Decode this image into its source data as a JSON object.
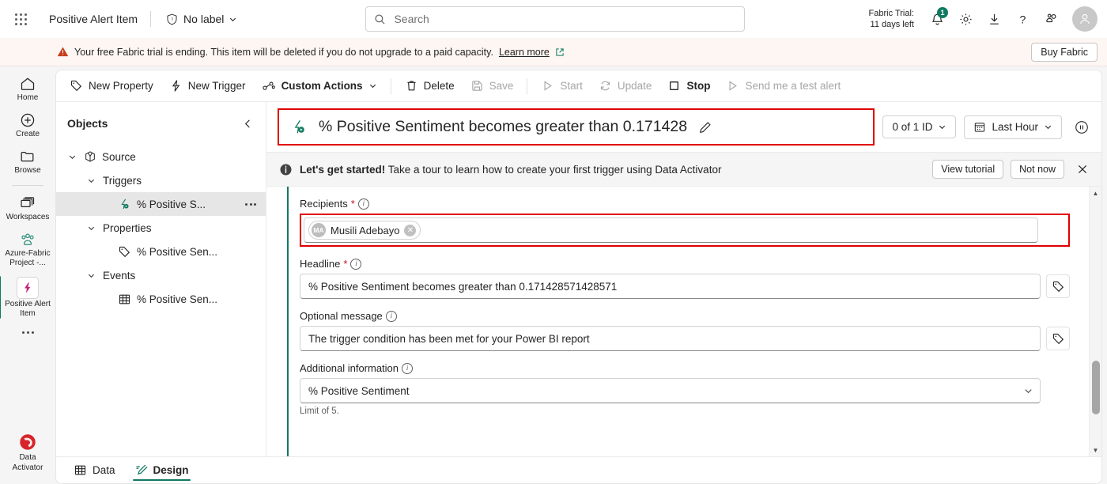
{
  "topbar": {
    "waffle_name": "app-launcher",
    "app_title": "Positive Alert Item",
    "label": "No label",
    "search_placeholder": "Search",
    "search_value": "",
    "trial_line1": "Fabric Trial:",
    "trial_line2": "11 days left",
    "notification_count": "1",
    "avatar_initial": ""
  },
  "trial_banner": {
    "message": "Your free Fabric trial is ending. This item will be deleted if you do not upgrade to a paid capacity.",
    "link": "Learn more",
    "buy_button": "Buy Fabric"
  },
  "rail": {
    "items": [
      {
        "label": "Home",
        "icon": "home-icon"
      },
      {
        "label": "Create",
        "icon": "plus-circle-icon"
      },
      {
        "label": "Browse",
        "icon": "folder-icon"
      },
      {
        "label": "Workspaces",
        "icon": "workspaces-icon"
      },
      {
        "label": "Azure-Fabric Project -...",
        "icon": "people-icon"
      },
      {
        "label": "Positive Alert Item",
        "icon": "activator-item-icon"
      }
    ],
    "more_label": "More options",
    "product": {
      "label_line1": "Data",
      "label_line2": "Activator",
      "icon": "data-activator-icon"
    }
  },
  "commandbar": {
    "items": [
      {
        "label": "New Property",
        "icon": "tag-icon",
        "disabled": false,
        "strong": false
      },
      {
        "label": "New Trigger",
        "icon": "bolt-icon",
        "disabled": false,
        "strong": false
      },
      {
        "label": "Custom Actions",
        "icon": "custom-actions-icon",
        "disabled": false,
        "strong": true,
        "caret": true
      },
      {
        "label": "Delete",
        "icon": "trash-icon",
        "disabled": false,
        "strong": false
      },
      {
        "label": "Save",
        "icon": "save-icon",
        "disabled": true,
        "strong": false
      },
      {
        "label": "Start",
        "icon": "play-icon",
        "disabled": true,
        "strong": false
      },
      {
        "label": "Update",
        "icon": "refresh-icon",
        "disabled": true,
        "strong": false
      },
      {
        "label": "Stop",
        "icon": "stop-icon",
        "disabled": false,
        "strong": true
      },
      {
        "label": "Send me a test alert",
        "icon": "play-icon",
        "disabled": true,
        "strong": false
      }
    ]
  },
  "objects": {
    "title": "Objects",
    "collapse_icon": "chevron-left-icon",
    "tree": [
      {
        "label": "Source",
        "icon": "source-cube-icon",
        "indent": 0,
        "expanded": true,
        "selected": false,
        "menu": false
      },
      {
        "label": "Triggers",
        "icon": "",
        "indent": 1,
        "expanded": true,
        "selected": false,
        "menu": false
      },
      {
        "label": "% Positive S...",
        "icon": "trigger-icon",
        "indent": 2,
        "expanded": null,
        "selected": true,
        "menu": true
      },
      {
        "label": "Properties",
        "icon": "",
        "indent": 1,
        "expanded": true,
        "selected": false,
        "menu": false
      },
      {
        "label": "% Positive Sen...",
        "icon": "tag-icon",
        "indent": 2,
        "expanded": null,
        "selected": false,
        "menu": false
      },
      {
        "label": "Events",
        "icon": "",
        "indent": 1,
        "expanded": true,
        "selected": false,
        "menu": false
      },
      {
        "label": "% Positive Sen...",
        "icon": "table-icon",
        "indent": 2,
        "expanded": null,
        "selected": false,
        "menu": false
      }
    ]
  },
  "detail": {
    "trigger_icon": "trigger-icon",
    "title": "% Positive Sentiment becomes greater than 0.171428",
    "edit_icon": "pencil-icon",
    "id_filter": "0 of 1 ID",
    "time_range": "Last Hour",
    "time_range_icon": "calendar-icon",
    "pause_icon": "pause-icon"
  },
  "tutorial": {
    "info_icon": "info-icon",
    "bold_text": "Let's get started!",
    "text": " Take a tour to learn how to create your first trigger using Data Activator",
    "view_tutorial": "View tutorial",
    "not_now": "Not now",
    "close_icon": "close-icon"
  },
  "form": {
    "recipients": {
      "label": "Recipients",
      "required": "*",
      "chip_initials": "MA",
      "chip_name": "Musili Adebayo",
      "remove_icon": "close-icon"
    },
    "headline": {
      "label": "Headline",
      "required": "*",
      "value": "% Positive Sentiment becomes greater than 0.171428571428571",
      "tag_icon": "tag-icon"
    },
    "optional_message": {
      "label": "Optional message",
      "value": "The trigger condition has been met for your Power BI report",
      "tag_icon": "tag-icon"
    },
    "additional_information": {
      "label": "Additional information",
      "value": "% Positive Sentiment",
      "hint": "Limit of 5.",
      "chevron_icon": "chevron-down-icon"
    }
  },
  "bottom_tabs": [
    {
      "label": "Data",
      "icon": "table-icon",
      "active": false
    },
    {
      "label": "Design",
      "icon": "design-pen-icon",
      "active": true
    }
  ],
  "colors": {
    "accent": "#117865",
    "highlight": "#e00000",
    "badge": "#0f7a5f",
    "warning": "#c43e1c",
    "required": "#c50f1f"
  }
}
